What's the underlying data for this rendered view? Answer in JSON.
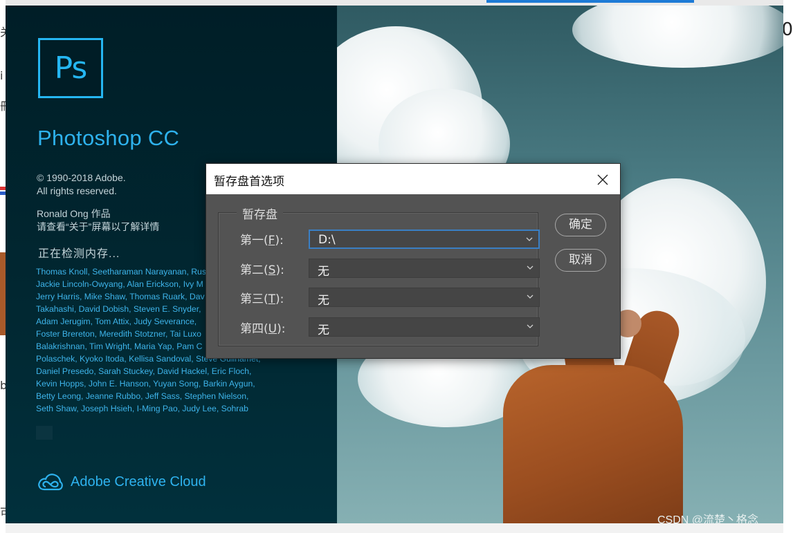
{
  "background": {
    "right_edge_text": "0",
    "left_edge_glyphs": [
      "关",
      "i",
      "冊",
      "b",
      "可"
    ]
  },
  "splash": {
    "logo_text": "Ps",
    "product_name": "Photoshop CC",
    "copyright_line1": "© 1990-2018 Adobe.",
    "copyright_line2": "All rights reserved.",
    "credit_line1": "Ronald Ong 作品",
    "credit_line2": "请查看“关于”屏幕以了解详情",
    "status": "正在检测内存...",
    "contributors": [
      "Thomas Knoll, Seetharaman Narayanan, Rus",
      "Jackie Lincoln-Owyang, Alan Erickson, Ivy M",
      "Jerry Harris, Mike Shaw, Thomas Ruark, Dav",
      "Takahashi, David Dobish, Steven E. Snyder,",
      "Adam Jerugim, Tom Attix, Judy Severance,",
      "Foster Brereton, Meredith Stotzner, Tai Luxo",
      "Balakrishnan, Tim Wright, Maria Yap, Pam C",
      "Polaschek, Kyoko Itoda, Kellisa Sandoval, Steve Guilhamet,",
      "Daniel Presedo, Sarah Stuckey, David Hackel, Eric Floch,",
      "Kevin Hopps, John E. Hanson, Yuyan Song, Barkin Aygun,",
      "Betty Leong, Jeanne Rubbo, Jeff Sass, Stephen Nielson,",
      "Seth Shaw, Joseph Hsieh, I-Ming Pao, Judy Lee, Sohrab"
    ],
    "brand": "Adobe Creative Cloud",
    "watermark": "CSDN @流楚丶格念"
  },
  "dialog": {
    "title": "暂存盘首选项",
    "group_label": "暂存盘",
    "rows": [
      {
        "prefix": "第一(",
        "key": "F",
        "suffix": "):",
        "value": "D:\\"
      },
      {
        "prefix": "第二(",
        "key": "S",
        "suffix": "):",
        "value": "无"
      },
      {
        "prefix": "第三(",
        "key": "T",
        "suffix": "):",
        "value": "无"
      },
      {
        "prefix": "第四(",
        "key": "U",
        "suffix": "):",
        "value": "无"
      }
    ],
    "ok_label": "确定",
    "cancel_label": "取消"
  },
  "colors": {
    "accent": "#2eb2ee",
    "dialog_bg": "#535353",
    "focus_border": "#3a7fc4"
  }
}
